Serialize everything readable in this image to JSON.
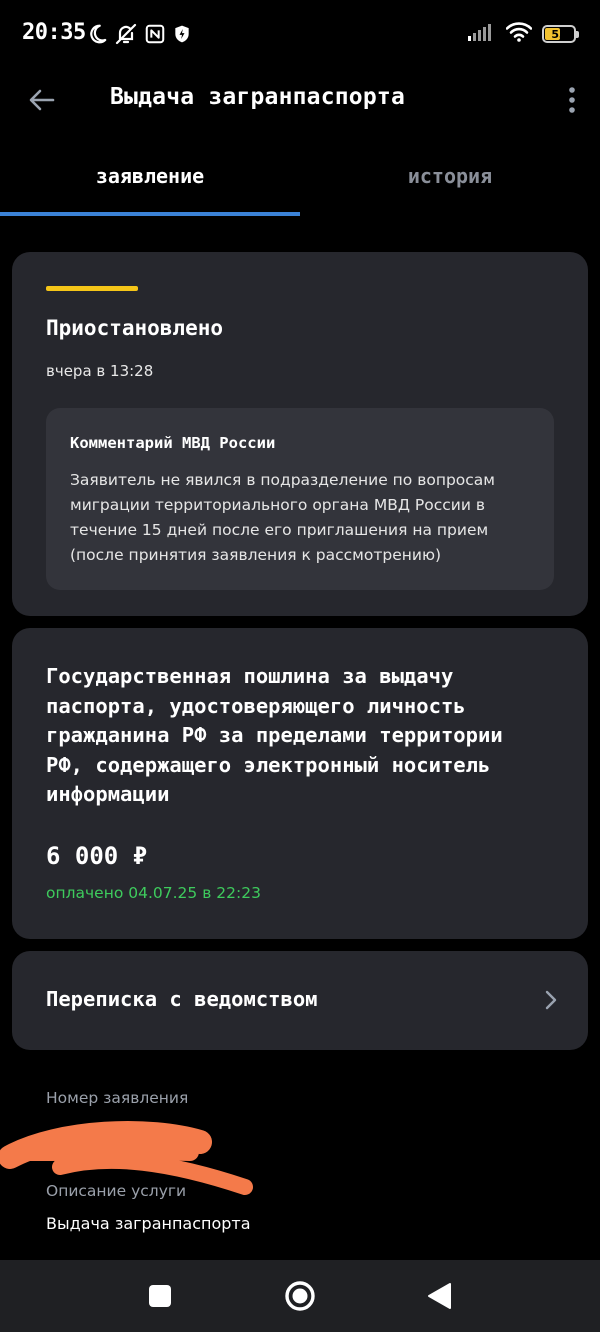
{
  "status_bar": {
    "time": "20:35",
    "battery_level": "53",
    "battery_fraction": 0.53,
    "icons_left": [
      "moon-icon",
      "bell-off-icon",
      "nfc-icon",
      "shield-icon"
    ],
    "icons_right": [
      "signal-icon",
      "wifi-icon",
      "battery-icon"
    ]
  },
  "app_bar": {
    "title": "Выдача загранпаспорта",
    "back_icon": "arrow-left-icon",
    "menu_icon": "more-vertical-icon"
  },
  "tabs": [
    {
      "label": "заявление",
      "active": true
    },
    {
      "label": "история",
      "active": false
    }
  ],
  "status_card": {
    "status": "Приостановлено",
    "date": "вчера в 13:28",
    "stripe_color": "#f5c518",
    "comment": {
      "title": "Комментарий МВД России",
      "lines": [
        "Заявитель не явился в подразделение по вопросам",
        "миграции территориального органа МВД России в",
        "течение 15 дней после его приглашения на прием",
        "(после принятия заявления к рассмотрению)"
      ]
    }
  },
  "fee_card": {
    "title_lines": [
      "Государственная пошлина за выдачу",
      "паспорта, удостоверяющего личность",
      "гражданина РФ за пределами территории",
      "РФ, содержащего электронный носитель",
      "информации"
    ],
    "amount": "6 000 ₽",
    "paid_status": "оплачено 04.07.25 в 22:23",
    "paid_color": "#3ecb5d"
  },
  "chat_card": {
    "label": "Переписка с ведомством",
    "chevron_icon": "chevron-right-icon"
  },
  "details": {
    "application_number_label": "Номер заявления",
    "service_description_label": "Описание услуги",
    "service_description_value": "Выдача загранпаспорта"
  },
  "nav_bar": {
    "buttons": [
      "recents-square-icon",
      "home-circle-icon",
      "back-triangle-icon"
    ]
  },
  "colors": {
    "background": "#000000",
    "card": "#26272d",
    "comment_box": "#33343b",
    "accent_tab": "#3b82d6",
    "redaction": "#f47a4a"
  }
}
